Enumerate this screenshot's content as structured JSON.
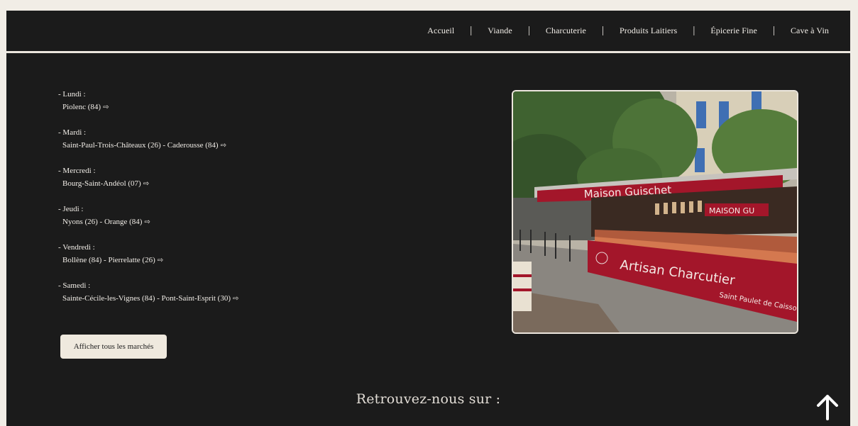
{
  "nav": {
    "items": [
      "Accueil",
      "Viande",
      "Charcuterie",
      "Produits Laitiers",
      "Épicerie Fine",
      "Cave à Vin"
    ],
    "separator": "|"
  },
  "schedule": [
    {
      "day": "- Lundi :",
      "places": "Piolenc (84)"
    },
    {
      "day": "- Mardi :",
      "places": "Saint-Paul-Trois-Châteaux (26) - Caderousse (84)"
    },
    {
      "day": "- Mercredi :",
      "places": "Bourg-Saint-Andéol (07)"
    },
    {
      "day": "- Jeudi :",
      "places": "Nyons (26) - Orange (84)"
    },
    {
      "day": "- Vendredi :",
      "places": "Bollène (84) - Pierrelatte (26)"
    },
    {
      "day": "- Samedi :",
      "places": "Sainte-Cécile-les-Vignes (84) - Pont-Saint-Esprit (30)"
    }
  ],
  "arrow_glyph": "⇨",
  "all_markets_button": "Afficher tous les marchés",
  "photo": {
    "sign_top": "Maison Guischet",
    "sign_front": "Artisan Charcutier",
    "sign_location": "Saint Paulet de Caisson",
    "awning_text": "MAISON GU"
  },
  "follow_title": "Retrouvez-nous sur :",
  "scroll_top_icon": "arrow-up-icon",
  "colors": {
    "background": "#1b1b1b",
    "outer": "#f1ede6",
    "text": "#f2eee8",
    "stall_red": "#a3162a"
  }
}
